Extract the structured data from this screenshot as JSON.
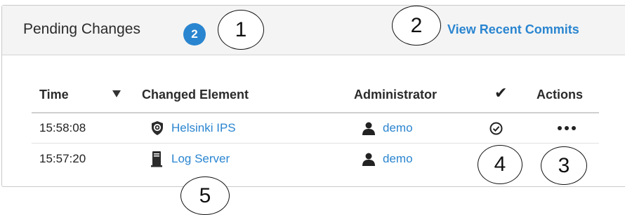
{
  "header": {
    "title": "Pending Changes",
    "badge_count": "2",
    "view_recent_link": "View Recent Commits"
  },
  "table": {
    "columns": [
      "Time",
      "Changed Element",
      "Administrator",
      "Actions"
    ],
    "approval_icon": "checkmark-icon",
    "rows": [
      {
        "time": "15:58:08",
        "element": "Helsinki IPS",
        "element_icon": "ips-shield-icon",
        "admin": "demo",
        "admin_icon": "user-icon",
        "approval_icon": "check-circle-icon",
        "actions_icon": "more-options-icon"
      },
      {
        "time": "15:57:20",
        "element": "Log Server",
        "element_icon": "server-icon",
        "admin": "demo",
        "admin_icon": "user-icon"
      }
    ]
  },
  "callouts": [
    "1",
    "2",
    "3",
    "4",
    "5"
  ],
  "colors": {
    "accent": "#2a85d0",
    "header_bg": "#f4f4f4",
    "border": "#c9c9c9"
  }
}
